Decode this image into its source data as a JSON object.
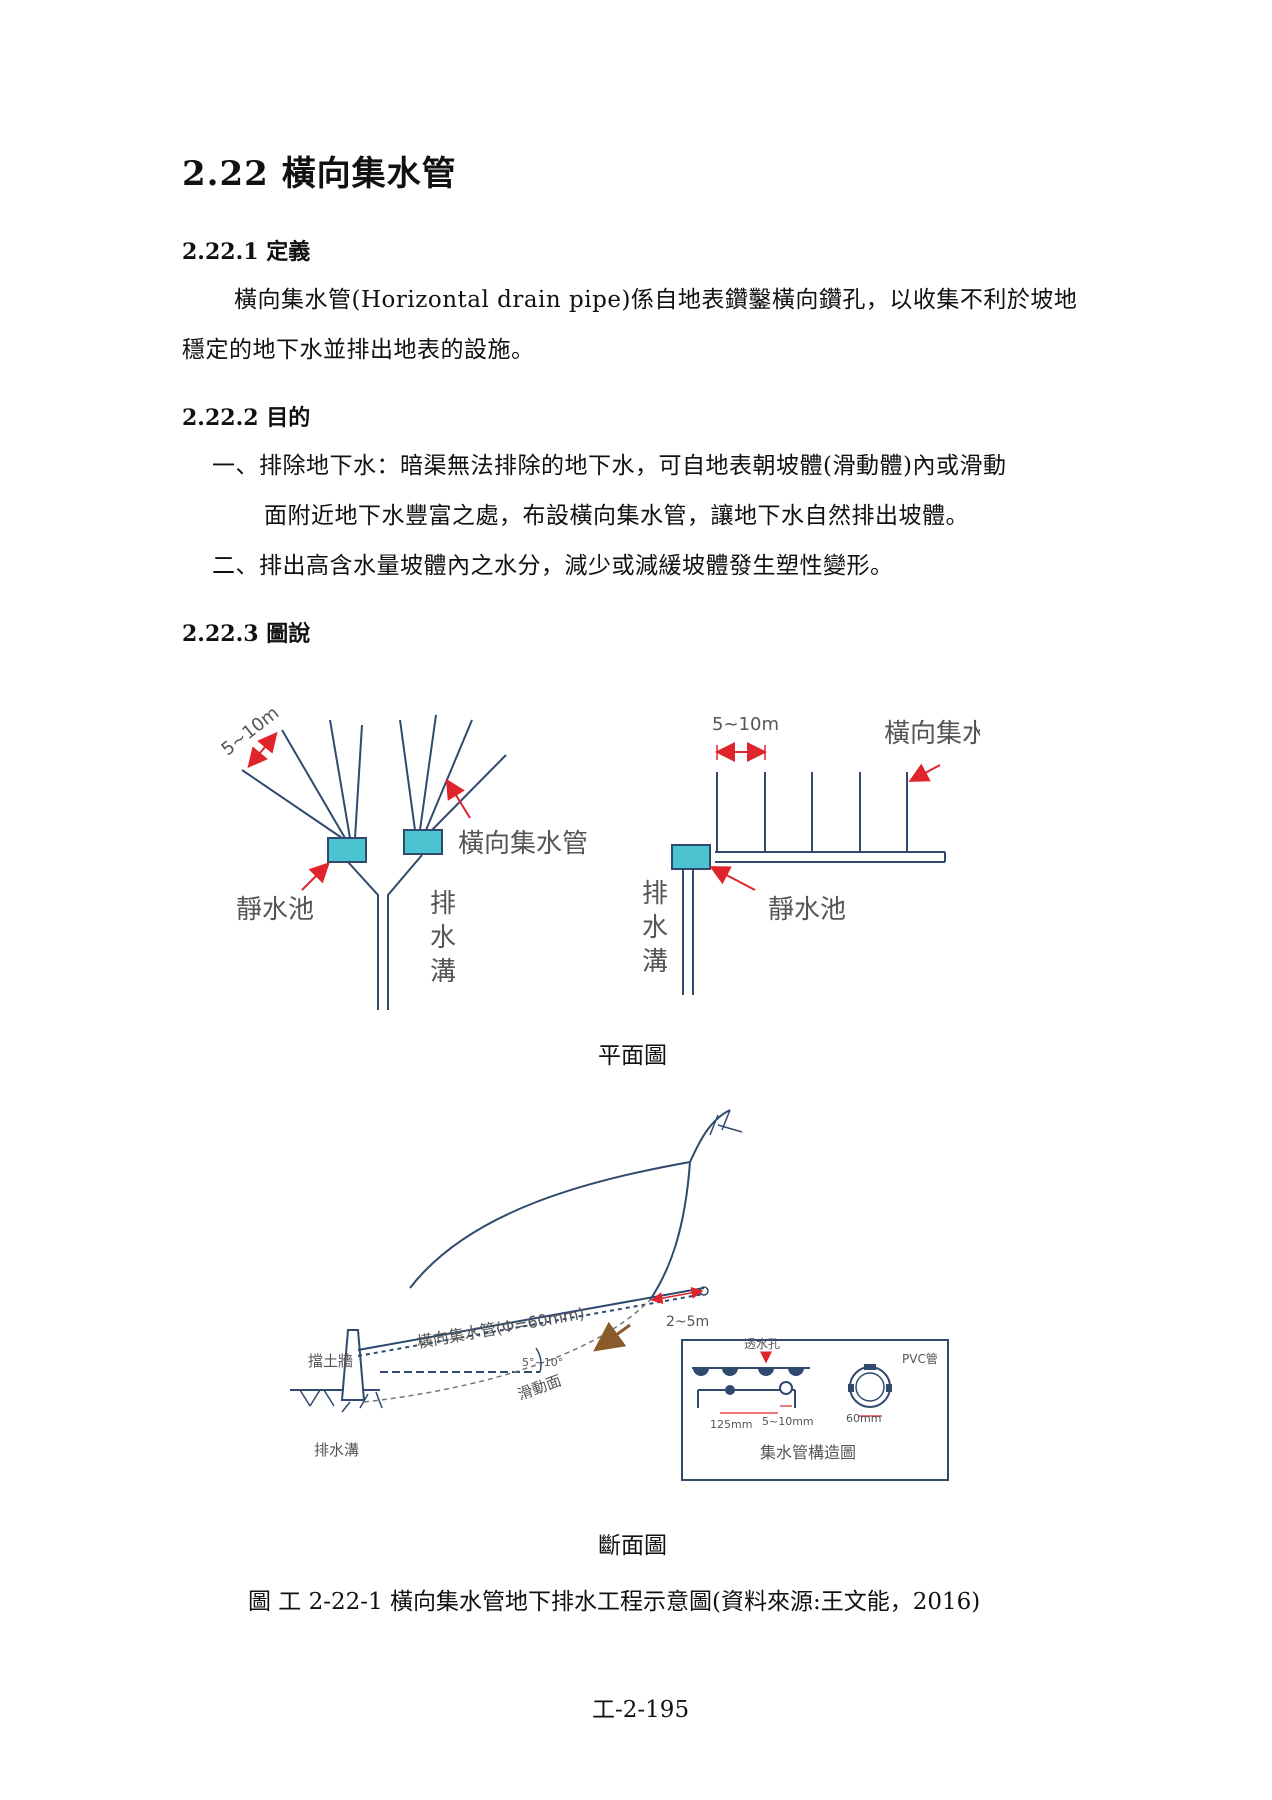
{
  "heading": "2.22  橫向集水管",
  "sections": {
    "definition": {
      "title": "2.22.1 定義",
      "para_line1": "橫向集水管(Horizontal drain pipe)係自地表鑽鑿橫向鑽孔，以收集不利於坡地",
      "para_line2": "穩定的地下水並排出地表的設施。"
    },
    "purpose": {
      "title": "2.22.2 目的",
      "item1_line1": "一、排除地下水：暗渠無法排除的地下水，可自地表朝坡體(滑動體)內或滑動",
      "item1_line2": "面附近地下水豐富之處，布設橫向集水管，讓地下水自然排出坡體。",
      "item2": "二、排出高含水量坡體內之水分，減少或減緩坡體發生塑性變形。"
    },
    "figure": {
      "title": "2.22.3 圖說"
    }
  },
  "plan_view": {
    "left": {
      "spacing": "5~10m",
      "pipe_label": "橫向集水管",
      "basin_label": "靜水池",
      "ditch_chars": [
        "排",
        "水",
        "溝"
      ]
    },
    "right": {
      "spacing": "5~10m",
      "pipe_label": "橫向集水管",
      "basin_label": "靜水池",
      "ditch_chars": [
        "排",
        "水",
        "溝"
      ]
    },
    "caption": "平面圖"
  },
  "section_view": {
    "retaining_wall": "擋土牆",
    "drain_ditch": "排水溝",
    "pipe_label": "橫向集水管(Φ=60mm)",
    "angle": "5°~10°",
    "slide_surface": "滑動面",
    "pipe_extension": "2~5m",
    "inset": {
      "perforation": "透水孔",
      "pvc": "PVC管",
      "dim_125": "125mm",
      "dim_spacing": "5~10mm",
      "dim_60": "60mm",
      "title": "集水管構造圖"
    },
    "caption": "斷面圖"
  },
  "figure_caption": "圖  工 2-22-1 橫向集水管地下排水工程示意圖(資料來源:王文能，2016)",
  "page_number": "工-2-195",
  "colors": {
    "line": "#2f4a6e",
    "basin": "#4cc3d1",
    "arrow": "#e0242b",
    "label": "#555555",
    "brown": "#8b5a2b"
  }
}
